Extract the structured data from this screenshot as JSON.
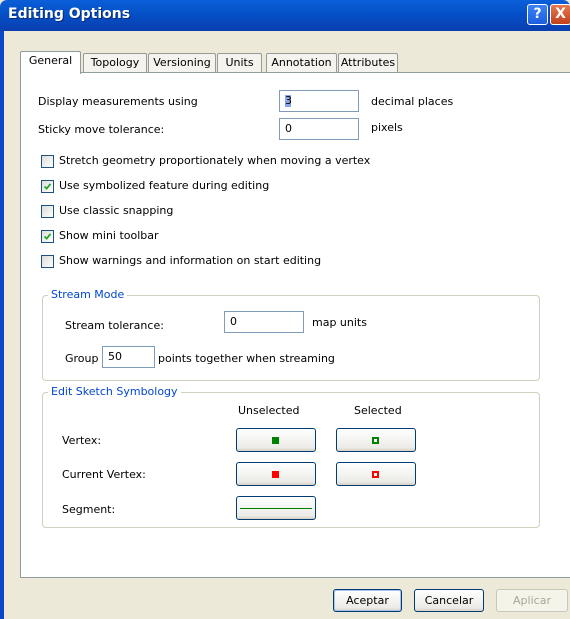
{
  "window": {
    "title": "Editing Options",
    "help_label": "?",
    "close_label": "X"
  },
  "tabs": [
    {
      "label": "General",
      "active": true
    },
    {
      "label": "Topology"
    },
    {
      "label": "Versioning"
    },
    {
      "label": "Units"
    },
    {
      "label": "Annotation"
    },
    {
      "label": "Attributes"
    }
  ],
  "general": {
    "display_measurements": {
      "label": "Display measurements using",
      "value": "3",
      "suffix": "decimal places"
    },
    "sticky_move": {
      "label": "Sticky move tolerance:",
      "value": "0",
      "suffix": "pixels"
    },
    "checkboxes": [
      {
        "label": "Stretch geometry proportionately when moving a vertex",
        "checked": false
      },
      {
        "label": "Use symbolized feature during editing",
        "checked": true
      },
      {
        "label": "Use classic snapping",
        "checked": false
      },
      {
        "label": "Show mini toolbar",
        "checked": true
      },
      {
        "label": "Show warnings and information on start editing",
        "checked": false
      }
    ],
    "stream_mode": {
      "legend": "Stream Mode",
      "tolerance_label": "Stream tolerance:",
      "tolerance_value": "0",
      "tolerance_suffix": "map units",
      "group_label": "Group",
      "group_value": "50",
      "group_suffix": "points together when streaming"
    },
    "sketch_symbology": {
      "legend": "Edit Sketch Symbology",
      "col_unselected": "Unselected",
      "col_selected": "Selected",
      "rows": [
        {
          "label": "Vertex:",
          "unselected_color": "#008000",
          "selected_color": "#008000"
        },
        {
          "label": "Current Vertex:",
          "unselected_color": "#ff0000",
          "selected_color": "#ff0000"
        },
        {
          "label": "Segment:",
          "line_color": "#008000"
        }
      ]
    }
  },
  "buttons": {
    "ok": "Aceptar",
    "cancel": "Cancelar",
    "apply": "Aplicar"
  }
}
